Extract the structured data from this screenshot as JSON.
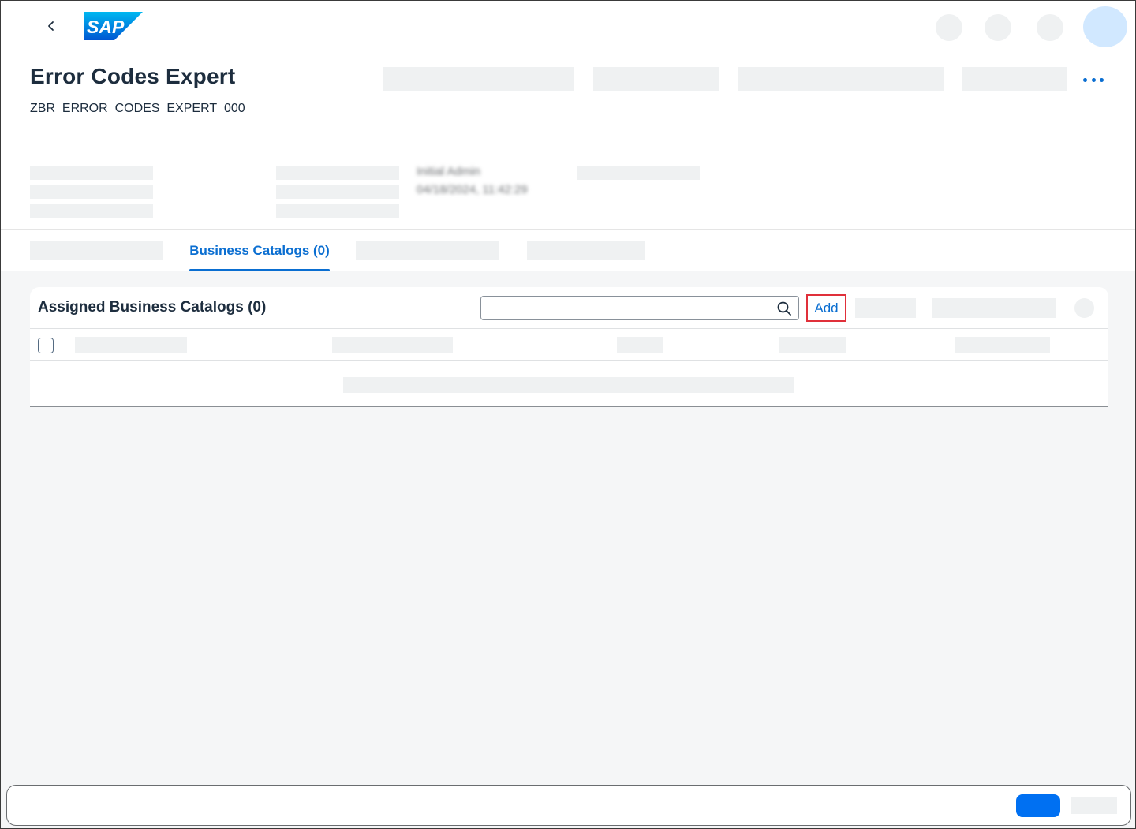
{
  "shell": {
    "logo_text": "SAP",
    "back_icon": "chevron-left-icon"
  },
  "header": {
    "title": "Error Codes Expert",
    "subtitle": "ZBR_ERROR_CODES_EXPERT_000",
    "more_icon": "overflow-more-icon",
    "changed_by": "Initial Admin",
    "changed_on": "04/18/2024, 11:42:29"
  },
  "tabs": {
    "active_label": "Business Catalogs (0)"
  },
  "table": {
    "title": "Assigned Business Catalogs (0)",
    "search": {
      "value": "",
      "placeholder": ""
    },
    "add_label": "Add"
  },
  "colors": {
    "accent": "#0a6ed1",
    "highlight_border": "#e0303a",
    "primary_button": "#0070f2",
    "skeleton": "#eff1f2"
  }
}
